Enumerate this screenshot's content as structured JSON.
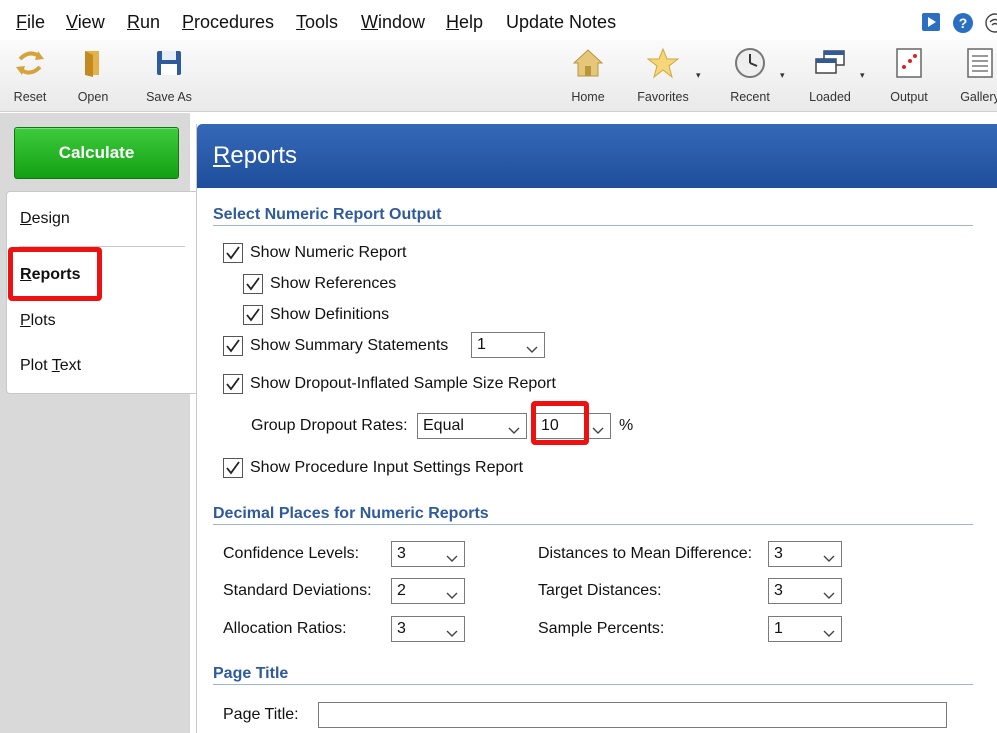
{
  "menu": {
    "items": [
      {
        "key": "file",
        "ul": "F",
        "rest": "ile"
      },
      {
        "key": "view",
        "ul": "V",
        "rest": "iew"
      },
      {
        "key": "run",
        "ul": "R",
        "rest": "un"
      },
      {
        "key": "procedures",
        "ul": "P",
        "rest": "rocedures"
      },
      {
        "key": "tools",
        "ul": "T",
        "rest": "ools"
      },
      {
        "key": "window",
        "ul": "W",
        "rest": "indow"
      },
      {
        "key": "help",
        "ul": "H",
        "rest": "elp"
      },
      {
        "key": "update-notes",
        "ul": "",
        "rest": "Update Notes"
      }
    ]
  },
  "toolbar": {
    "reset": "Reset",
    "open": "Open",
    "save_as": "Save As",
    "home": "Home",
    "favorites": "Favorites",
    "recent": "Recent",
    "loaded": "Loaded",
    "output": "Output",
    "gallery": "Gallery",
    "dropdown_glyph": "▾"
  },
  "left": {
    "calculate": "Calculate",
    "tabs": {
      "design": {
        "ul": "D",
        "rest": "esign"
      },
      "reports": {
        "ul": "R",
        "rest": "eports"
      },
      "plots": {
        "ul": "P",
        "rest": "lots"
      },
      "plot_text": {
        "pre": "Plot ",
        "ul": "T",
        "rest": "ext"
      }
    }
  },
  "content": {
    "header": {
      "ul": "R",
      "rest": "eports"
    },
    "section1": "Select Numeric Report Output",
    "show_numeric_report": "Show Numeric Report",
    "show_references": "Show References",
    "show_definitions": "Show Definitions",
    "show_summary_statements": "Show Summary Statements",
    "summary_value": "1",
    "show_dropout_report": "Show Dropout-Inflated Sample Size Report",
    "group_dropout_label": "Group Dropout Rates:",
    "group_dropout_mode": "Equal",
    "dropout_value": "10",
    "percent": "%",
    "show_input_settings": "Show Procedure Input Settings Report",
    "section2": "Decimal Places for Numeric Reports",
    "confidence_levels_label": "Confidence Levels:",
    "confidence_levels_value": "3",
    "standard_deviations_label": "Standard Deviations:",
    "standard_deviations_value": "2",
    "allocation_ratios_label": "Allocation Ratios:",
    "allocation_ratios_value": "3",
    "distances_label": "Distances to Mean Difference:",
    "distances_value": "3",
    "target_distances_label": "Target Distances:",
    "target_distances_value": "3",
    "sample_percents_label": "Sample Percents:",
    "sample_percents_value": "1",
    "section3": "Page Title",
    "page_title_label": "Page Title:",
    "page_title_value": ""
  },
  "colors": {
    "accent_blue": "#2f5a9c",
    "header_blue": "#2a5ba9",
    "calculate_green": "#22b022",
    "highlight_red": "#ee1111"
  }
}
